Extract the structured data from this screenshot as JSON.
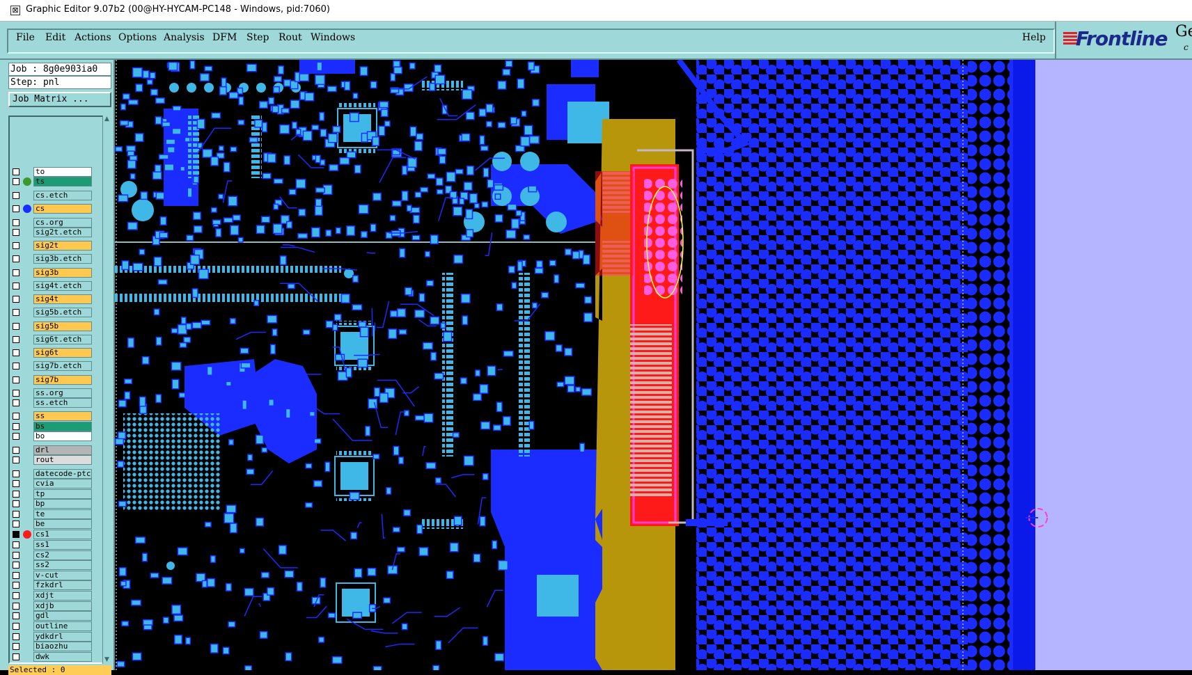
{
  "window": {
    "title": "Graphic Editor 9.07b2 (00@HY-HYCAM-PC148 - Windows, pid:7060)"
  },
  "menu": {
    "items": [
      "File",
      "Edit",
      "Actions",
      "Options",
      "Analysis",
      "DFM",
      "Step",
      "Rout",
      "Windows"
    ],
    "help": "Help"
  },
  "logo": {
    "text": "Frontline",
    "side": "Ge",
    "side2": "c"
  },
  "job": {
    "job_line": "Job : 8g0e903ia0",
    "step_line": "Step: pnl",
    "matrix_button": "Job Matrix ..."
  },
  "layers": [
    {
      "name": "to",
      "bg": "#ffffff",
      "dot": ""
    },
    {
      "name": "ts",
      "bg": "#1c9c74",
      "dot": "#3a9a2a"
    },
    {
      "name": "cs.etch",
      "bg": "#9ed8d8",
      "dot": ""
    },
    {
      "name": "cs",
      "bg": "#ffc850",
      "dot": "#1a2cff"
    },
    {
      "name": "cs.org",
      "bg": "#9ed8d8",
      "dot": ""
    },
    {
      "name": "sig2t.etch",
      "bg": "#9ed8d8",
      "dot": ""
    },
    {
      "name": "sig2t",
      "bg": "#ffc850",
      "dot": ""
    },
    {
      "name": "sig3b.etch",
      "bg": "#9ed8d8",
      "dot": ""
    },
    {
      "name": "sig3b",
      "bg": "#ffc850",
      "dot": ""
    },
    {
      "name": "sig4t.etch",
      "bg": "#9ed8d8",
      "dot": ""
    },
    {
      "name": "sig4t",
      "bg": "#ffc850",
      "dot": ""
    },
    {
      "name": "sig5b.etch",
      "bg": "#9ed8d8",
      "dot": ""
    },
    {
      "name": "sig5b",
      "bg": "#ffc850",
      "dot": ""
    },
    {
      "name": "sig6t.etch",
      "bg": "#9ed8d8",
      "dot": ""
    },
    {
      "name": "sig6t",
      "bg": "#ffc850",
      "dot": ""
    },
    {
      "name": "sig7b.etch",
      "bg": "#9ed8d8",
      "dot": ""
    },
    {
      "name": "sig7b",
      "bg": "#ffc850",
      "dot": ""
    },
    {
      "name": "ss.org",
      "bg": "#9ed8d8",
      "dot": ""
    },
    {
      "name": "ss.etch",
      "bg": "#9ed8d8",
      "dot": ""
    },
    {
      "name": "ss",
      "bg": "#ffc850",
      "dot": ""
    },
    {
      "name": "bs",
      "bg": "#1c9c74",
      "dot": ""
    },
    {
      "name": "bo",
      "bg": "#ffffff",
      "dot": ""
    },
    {
      "name": "drl",
      "bg": "#b4b4b4",
      "dot": ""
    },
    {
      "name": "rout",
      "bg": "#dcdcdc",
      "dot": ""
    },
    {
      "name": "datecode-ptc",
      "bg": "#9ed8d8",
      "dot": ""
    },
    {
      "name": "cvia",
      "bg": "#9ed8d8",
      "dot": ""
    },
    {
      "name": "tp",
      "bg": "#9ed8d8",
      "dot": ""
    },
    {
      "name": "bp",
      "bg": "#9ed8d8",
      "dot": ""
    },
    {
      "name": "te",
      "bg": "#9ed8d8",
      "dot": ""
    },
    {
      "name": "be",
      "bg": "#9ed8d8",
      "dot": ""
    },
    {
      "name": "cs1",
      "bg": "#9ed8d8",
      "dot": "#ff1a1a",
      "checked": true
    },
    {
      "name": "ss1",
      "bg": "#9ed8d8",
      "dot": ""
    },
    {
      "name": "cs2",
      "bg": "#9ed8d8",
      "dot": ""
    },
    {
      "name": "ss2",
      "bg": "#9ed8d8",
      "dot": ""
    },
    {
      "name": "v-cut",
      "bg": "#9ed8d8",
      "dot": ""
    },
    {
      "name": "fzkdrl",
      "bg": "#9ed8d8",
      "dot": ""
    },
    {
      "name": "xdjt",
      "bg": "#9ed8d8",
      "dot": ""
    },
    {
      "name": "xdjb",
      "bg": "#9ed8d8",
      "dot": ""
    },
    {
      "name": "gdl",
      "bg": "#9ed8d8",
      "dot": ""
    },
    {
      "name": "outline",
      "bg": "#9ed8d8",
      "dot": ""
    },
    {
      "name": "ydkdrl",
      "bg": "#9ed8d8",
      "dot": ""
    },
    {
      "name": "biaozhu",
      "bg": "#9ed8d8",
      "dot": ""
    },
    {
      "name": "dwk",
      "bg": "#9ed8d8",
      "dot": ""
    }
  ],
  "status": {
    "selected": "Selected : 0"
  },
  "colors": {
    "panel": "#9ed8d8",
    "board_bg": "#000000",
    "copper_blue": "#1a2cff",
    "pad_cyan": "#3fb8e8",
    "gold": "#b8960c",
    "red": "#ff1a1a",
    "magenta": "#ff3cd8",
    "lavender": "#b4b4ff"
  }
}
